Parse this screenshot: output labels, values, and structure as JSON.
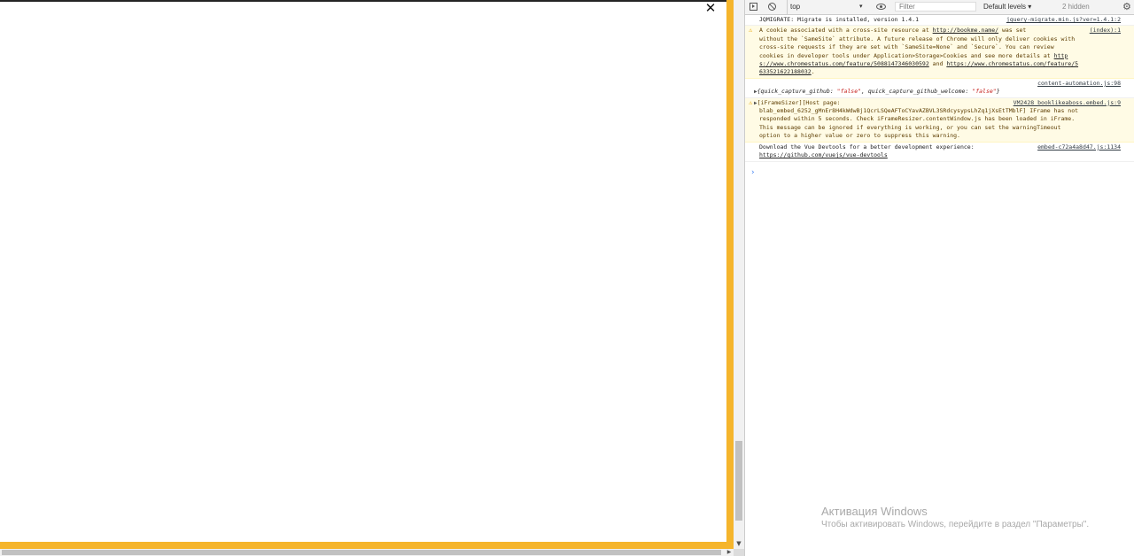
{
  "page": {
    "close_glyph": "✕"
  },
  "scrollbars": {
    "down_arrow": "▼",
    "right_arrow": "▶"
  },
  "colors": {
    "accent": "#f5b52c",
    "warning_bg": "#fffbe5",
    "string_value": "#c41a16",
    "prompt": "#4285f4"
  },
  "devtools": {
    "toolbar": {
      "sidebar_icon": "sidebar-toggle-icon",
      "clear_icon": "clear-console-icon",
      "context": "top",
      "context_arrow": "▾",
      "eye_icon": "eye-icon",
      "filter_placeholder": "Filter",
      "levels": "Default levels ▾",
      "hidden": "2 hidden",
      "settings_icon": "⚙"
    },
    "messages": [
      {
        "lines": [
          "JQMIGRATE: Migrate is installed, version 1.4.1"
        ],
        "source": "jquery-migrate.min.js?ver=1.4.1:2"
      },
      {
        "level": "warning",
        "source": "(index):1",
        "l1_pre": "A cookie associated with a cross-site resource at ",
        "l1_link": "http://bookme.name/",
        "l1_post": " was set",
        "l2": "without the `SameSite` attribute. A future release of Chrome will only deliver cookies with",
        "l3": "cross-site requests if they are set with `SameSite=None` and `Secure`. You can review",
        "l4_pre": "cookies in developer tools under Application>Storage>Cookies and see more details at ",
        "l4_link": "http",
        "l5_link": "s://www.chromestatus.com/feature/5088147346030592",
        "l5_mid": " and ",
        "l5_link2": "https://www.chromestatus.com/feature/5",
        "l6_link": "633521622188032",
        "l6_post": "."
      },
      {
        "source": "content-automation.js:98",
        "obj_key1": "quick_capture_github",
        "obj_val1": "\"false\"",
        "obj_key2": "quick_capture_github_welcome",
        "obj_val2": "\"false\""
      },
      {
        "level": "warning",
        "source": "VM2428 booklikeaboss.embed.js:9",
        "l1": "[iFrameSizer][Host page:",
        "l2": "blab_embed_6252_gMnEr8H4kWdwBj1QcrLSQeAFToCYavAZBVL3SRdcysypsLhZq1jXsEtTMblF] IFrame has not",
        "l3": "responded within 5 seconds. Check iFrameResizer.contentWindow.js has been loaded in iFrame.",
        "l4": "This message can be ignored if everything is working, or you can set the warningTimeout",
        "l5": "option to a higher value or zero to suppress this warning."
      },
      {
        "source": "embed-c72a4a8d47.js:1134",
        "l1": "Download the Vue Devtools for a better development experience:",
        "l2_link": "https://github.com/vuejs/vue-devtools"
      }
    ],
    "prompt": "›"
  },
  "watermark": {
    "title": "Активация Windows",
    "subtitle": "Чтобы активировать Windows, перейдите в раздел \"Параметры\"."
  }
}
